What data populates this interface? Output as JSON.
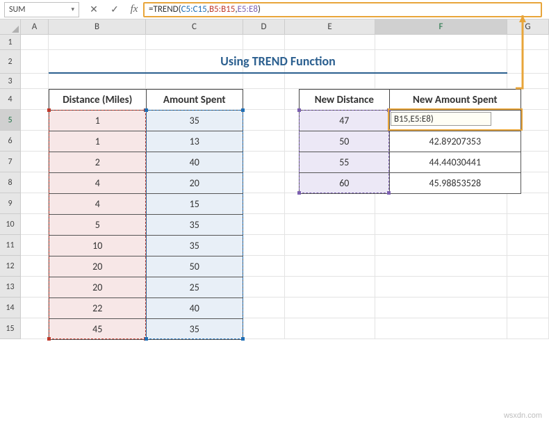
{
  "namebox": {
    "value": "SUM",
    "dropdown_icon": "▾"
  },
  "formula_bar": {
    "cancel_icon": "✕",
    "enter_icon": "✓",
    "fx_label": "fx",
    "eq": "=",
    "fn_name": "TREND",
    "open": "(",
    "arg1": "C5:C15",
    "sep1": ",",
    "arg2": "B5:B15",
    "sep2": ",",
    "arg3": "E5:E8",
    "close": ")"
  },
  "columns": [
    "A",
    "B",
    "C",
    "D",
    "E",
    "F",
    "G"
  ],
  "rows": [
    "1",
    "2",
    "3",
    "4",
    "5",
    "6",
    "7",
    "8",
    "9",
    "10",
    "11",
    "12",
    "13",
    "14",
    "15"
  ],
  "title": "Using TREND Function",
  "table_a": {
    "headers": [
      "Distance (Miles)",
      "Amount Spent"
    ],
    "rows": [
      [
        "1",
        "35"
      ],
      [
        "1",
        "13"
      ],
      [
        "2",
        "40"
      ],
      [
        "4",
        "20"
      ],
      [
        "4",
        "15"
      ],
      [
        "5",
        "35"
      ],
      [
        "10",
        "35"
      ],
      [
        "20",
        "50"
      ],
      [
        "20",
        "25"
      ],
      [
        "22",
        "40"
      ],
      [
        "45",
        "35"
      ]
    ]
  },
  "table_b": {
    "headers": [
      "New Distance",
      "New Amount Spent"
    ],
    "rows": [
      [
        "47",
        ""
      ],
      [
        "50",
        "42.89207353"
      ],
      [
        "55",
        "44.44030441"
      ],
      [
        "60",
        "45.98853528"
      ]
    ]
  },
  "editing_cell_text": "B15,E5:E8)",
  "watermark": "wsxdn.com",
  "chart_data": {
    "type": "table",
    "title": "Using TREND Function",
    "left_table": {
      "columns": [
        "Distance (Miles)",
        "Amount Spent"
      ],
      "data": [
        [
          1,
          35
        ],
        [
          1,
          13
        ],
        [
          2,
          40
        ],
        [
          4,
          20
        ],
        [
          4,
          15
        ],
        [
          5,
          35
        ],
        [
          10,
          35
        ],
        [
          20,
          50
        ],
        [
          20,
          25
        ],
        [
          22,
          40
        ],
        [
          45,
          35
        ]
      ]
    },
    "right_table": {
      "columns": [
        "New Distance",
        "New Amount Spent"
      ],
      "data": [
        [
          47,
          null
        ],
        [
          50,
          42.89207353
        ],
        [
          55,
          44.44030441
        ],
        [
          60,
          45.98853528
        ]
      ],
      "formula": "=TREND(C5:C15,B5:B15,E5:E8)"
    }
  }
}
